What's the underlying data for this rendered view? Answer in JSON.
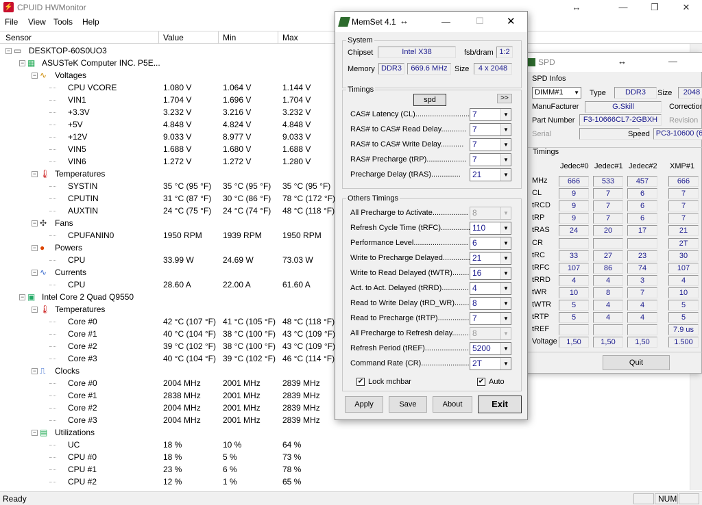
{
  "hwmonitor": {
    "title": "CPUID HWMonitor",
    "menu": [
      "File",
      "View",
      "Tools",
      "Help"
    ],
    "columns": [
      "Sensor",
      "Value",
      "Min",
      "Max"
    ],
    "rows": [
      {
        "label": "DESKTOP-60S0UO3",
        "level": 0,
        "icon": "computer-icon",
        "expander": "−"
      },
      {
        "label": "ASUSTeK Computer INC. P5E...",
        "level": 1,
        "icon": "motherboard-icon",
        "expander": "−"
      },
      {
        "label": "Voltages",
        "level": 2,
        "icon": "voltage-icon",
        "expander": "−"
      },
      {
        "label": "CPU VCORE",
        "level": 3,
        "value": "1.080 V",
        "min": "1.064 V",
        "max": "1.144 V"
      },
      {
        "label": "VIN1",
        "level": 3,
        "value": "1.704 V",
        "min": "1.696 V",
        "max": "1.704 V"
      },
      {
        "label": "+3.3V",
        "level": 3,
        "value": "3.232 V",
        "min": "3.216 V",
        "max": "3.232 V"
      },
      {
        "label": "+5V",
        "level": 3,
        "value": "4.848 V",
        "min": "4.824 V",
        "max": "4.848 V"
      },
      {
        "label": "+12V",
        "level": 3,
        "value": "9.033 V",
        "min": "8.977 V",
        "max": "9.033 V"
      },
      {
        "label": "VIN5",
        "level": 3,
        "value": "1.688 V",
        "min": "1.680 V",
        "max": "1.688 V"
      },
      {
        "label": "VIN6",
        "level": 3,
        "value": "1.272 V",
        "min": "1.272 V",
        "max": "1.280 V"
      },
      {
        "label": "Temperatures",
        "level": 2,
        "icon": "temperature-icon",
        "expander": "−"
      },
      {
        "label": "SYSTIN",
        "level": 3,
        "value": "35 °C  (95 °F)",
        "min": "35 °C  (95 °F)",
        "max": "35 °C  (95 °F)"
      },
      {
        "label": "CPUTIN",
        "level": 3,
        "value": "31 °C  (87 °F)",
        "min": "30 °C  (86 °F)",
        "max": "78 °C  (172 °F)"
      },
      {
        "label": "AUXTIN",
        "level": 3,
        "value": "24 °C  (75 °F)",
        "min": "24 °C  (74 °F)",
        "max": "48 °C  (118 °F)"
      },
      {
        "label": "Fans",
        "level": 2,
        "icon": "fan-icon",
        "expander": "−"
      },
      {
        "label": "CPUFANIN0",
        "level": 3,
        "value": "1950 RPM",
        "min": "1939 RPM",
        "max": "1950 RPM"
      },
      {
        "label": "Powers",
        "level": 2,
        "icon": "power-icon",
        "expander": "−"
      },
      {
        "label": "CPU",
        "level": 3,
        "value": "33.99 W",
        "min": "24.69 W",
        "max": "73.03 W"
      },
      {
        "label": "Currents",
        "level": 2,
        "icon": "current-icon",
        "expander": "−"
      },
      {
        "label": "CPU",
        "level": 3,
        "value": "28.60 A",
        "min": "22.00 A",
        "max": "61.60 A"
      },
      {
        "label": "Intel Core 2 Quad Q9550",
        "level": 1,
        "icon": "cpu-icon",
        "expander": "−"
      },
      {
        "label": "Temperatures",
        "level": 2,
        "icon": "temperature-icon",
        "expander": "−"
      },
      {
        "label": "Core #0",
        "level": 3,
        "value": "42 °C  (107 °F)",
        "min": "41 °C  (105 °F)",
        "max": "48 °C  (118 °F)"
      },
      {
        "label": "Core #1",
        "level": 3,
        "value": "40 °C  (104 °F)",
        "min": "38 °C  (100 °F)",
        "max": "43 °C  (109 °F)"
      },
      {
        "label": "Core #2",
        "level": 3,
        "value": "39 °C  (102 °F)",
        "min": "38 °C  (100 °F)",
        "max": "43 °C  (109 °F)"
      },
      {
        "label": "Core #3",
        "level": 3,
        "value": "40 °C  (104 °F)",
        "min": "39 °C  (102 °F)",
        "max": "46 °C  (114 °F)"
      },
      {
        "label": "Clocks",
        "level": 2,
        "icon": "clock-icon",
        "expander": "−"
      },
      {
        "label": "Core #0",
        "level": 3,
        "value": "2004 MHz",
        "min": "2001 MHz",
        "max": "2839 MHz"
      },
      {
        "label": "Core #1",
        "level": 3,
        "value": "2838 MHz",
        "min": "2001 MHz",
        "max": "2839 MHz"
      },
      {
        "label": "Core #2",
        "level": 3,
        "value": "2004 MHz",
        "min": "2001 MHz",
        "max": "2839 MHz"
      },
      {
        "label": "Core #3",
        "level": 3,
        "value": "2004 MHz",
        "min": "2001 MHz",
        "max": "2839 MHz"
      },
      {
        "label": "Utilizations",
        "level": 2,
        "icon": "utilization-icon",
        "expander": "−"
      },
      {
        "label": "UC",
        "level": 3,
        "value": "18 %",
        "min": "10 %",
        "max": "64 %"
      },
      {
        "label": "CPU #0",
        "level": 3,
        "value": "18 %",
        "min": "5 %",
        "max": "73 %"
      },
      {
        "label": "CPU #1",
        "level": 3,
        "value": "23 %",
        "min": "6 %",
        "max": "78 %"
      },
      {
        "label": "CPU #2",
        "level": 3,
        "value": "12 %",
        "min": "1 %",
        "max": "65 %"
      }
    ],
    "status": "Ready",
    "status_num": "NUM"
  },
  "memset": {
    "title": "MemSet 4.1",
    "system_title": "System",
    "chipset_label": "Chipset",
    "chipset_value": "Intel  X38",
    "fsb_label": "fsb/dram",
    "fsb_value": "1:2",
    "memory_label": "Memory",
    "memory_type": "DDR3",
    "memory_freq": "669.6 MHz",
    "size_label": "Size",
    "size_value": "4 x 2048",
    "timings_title": "Timings",
    "spd_button": "spd",
    "more_button": ">>",
    "timings": [
      {
        "label": "CAS# Latency (CL)..........................",
        "value": "7"
      },
      {
        "label": "RAS# to CAS# Read Delay............",
        "value": "7"
      },
      {
        "label": "RAS# to CAS# Write Delay...........",
        "value": "7"
      },
      {
        "label": "RAS# Precharge (tRP)...................",
        "value": "7"
      },
      {
        "label": "Precharge Delay  (tRAS)..............",
        "value": "21"
      }
    ],
    "others_title": "Others Timings",
    "others": [
      {
        "label": "All Precharge to Activate.................",
        "value": "8",
        "disabled": true
      },
      {
        "label": "Refresh Cycle Time (tRFC)...............",
        "value": "110"
      },
      {
        "label": "Performance Level..........................",
        "value": "6"
      },
      {
        "label": "Write to Precharge Delayed..............",
        "value": "21"
      },
      {
        "label": "Write to Read Delayed (tWTR)..........",
        "value": "16"
      },
      {
        "label": "Act. to Act. Delayed (tRRD).............",
        "value": "4"
      },
      {
        "label": "Read to Write Delay (tRD_WR).........",
        "value": "8"
      },
      {
        "label": "Read to Precharge (tRTP)...............",
        "value": "7"
      },
      {
        "label": "All Precharge to Refresh delay..........",
        "value": "8",
        "disabled": true
      },
      {
        "label": "Refresh Period (tREF).....................",
        "value": "5200"
      },
      {
        "label": "Command Rate (CR).........................",
        "value": "2T"
      }
    ],
    "lock_label": "Lock mchbar",
    "auto_label": "Auto",
    "buttons": {
      "apply": "Apply",
      "save": "Save",
      "about": "About",
      "exit": "Exit"
    }
  },
  "spd": {
    "title": "SPD",
    "infos_title": "SPD Infos",
    "dimm_value": "DIMM#1",
    "type_label": "Type",
    "type_value": "DDR3",
    "size_label": "Size",
    "size_value": "2048",
    "manufacturer_label": "ManuFacturer",
    "manufacturer_value": "G.Skill",
    "correction_label": "Correction",
    "partnumber_label": "Part Number",
    "partnumber_value": "F3-10666CL7-2GBXH",
    "revision_label": "Revision",
    "serial_label": "Serial",
    "speed_label": "Speed",
    "speed_value": "PC3-10600 (6",
    "timings_title": "Timings",
    "columns": [
      "Jedec#0",
      "Jedec#1",
      "Jedec#2",
      "XMP#1"
    ],
    "rows": [
      {
        "label": "MHz",
        "values": [
          "666",
          "533",
          "457",
          "666"
        ]
      },
      {
        "label": "CL",
        "values": [
          "9",
          "7",
          "6",
          "7"
        ]
      },
      {
        "label": "tRCD",
        "values": [
          "9",
          "7",
          "6",
          "7"
        ]
      },
      {
        "label": "tRP",
        "values": [
          "9",
          "7",
          "6",
          "7"
        ]
      },
      {
        "label": "tRAS",
        "values": [
          "24",
          "20",
          "17",
          "21"
        ]
      },
      {
        "label": "CR",
        "values": [
          "",
          "",
          "",
          "2T"
        ]
      },
      {
        "label": "tRC",
        "values": [
          "33",
          "27",
          "23",
          "30"
        ]
      },
      {
        "label": "tRFC",
        "values": [
          "107",
          "86",
          "74",
          "107"
        ]
      },
      {
        "label": "tRRD",
        "values": [
          "4",
          "4",
          "3",
          "4"
        ]
      },
      {
        "label": "tWR",
        "values": [
          "10",
          "8",
          "7",
          "10"
        ]
      },
      {
        "label": "tWTR",
        "values": [
          "5",
          "4",
          "4",
          "5"
        ]
      },
      {
        "label": "tRTP",
        "values": [
          "5",
          "4",
          "4",
          "5"
        ]
      },
      {
        "label": "tREF",
        "values": [
          "",
          "",
          "",
          "7.9 us"
        ]
      },
      {
        "label": "Voltage",
        "values": [
          "1,50",
          "1,50",
          "1,50",
          "1.500"
        ]
      }
    ],
    "quit_button": "Quit"
  }
}
